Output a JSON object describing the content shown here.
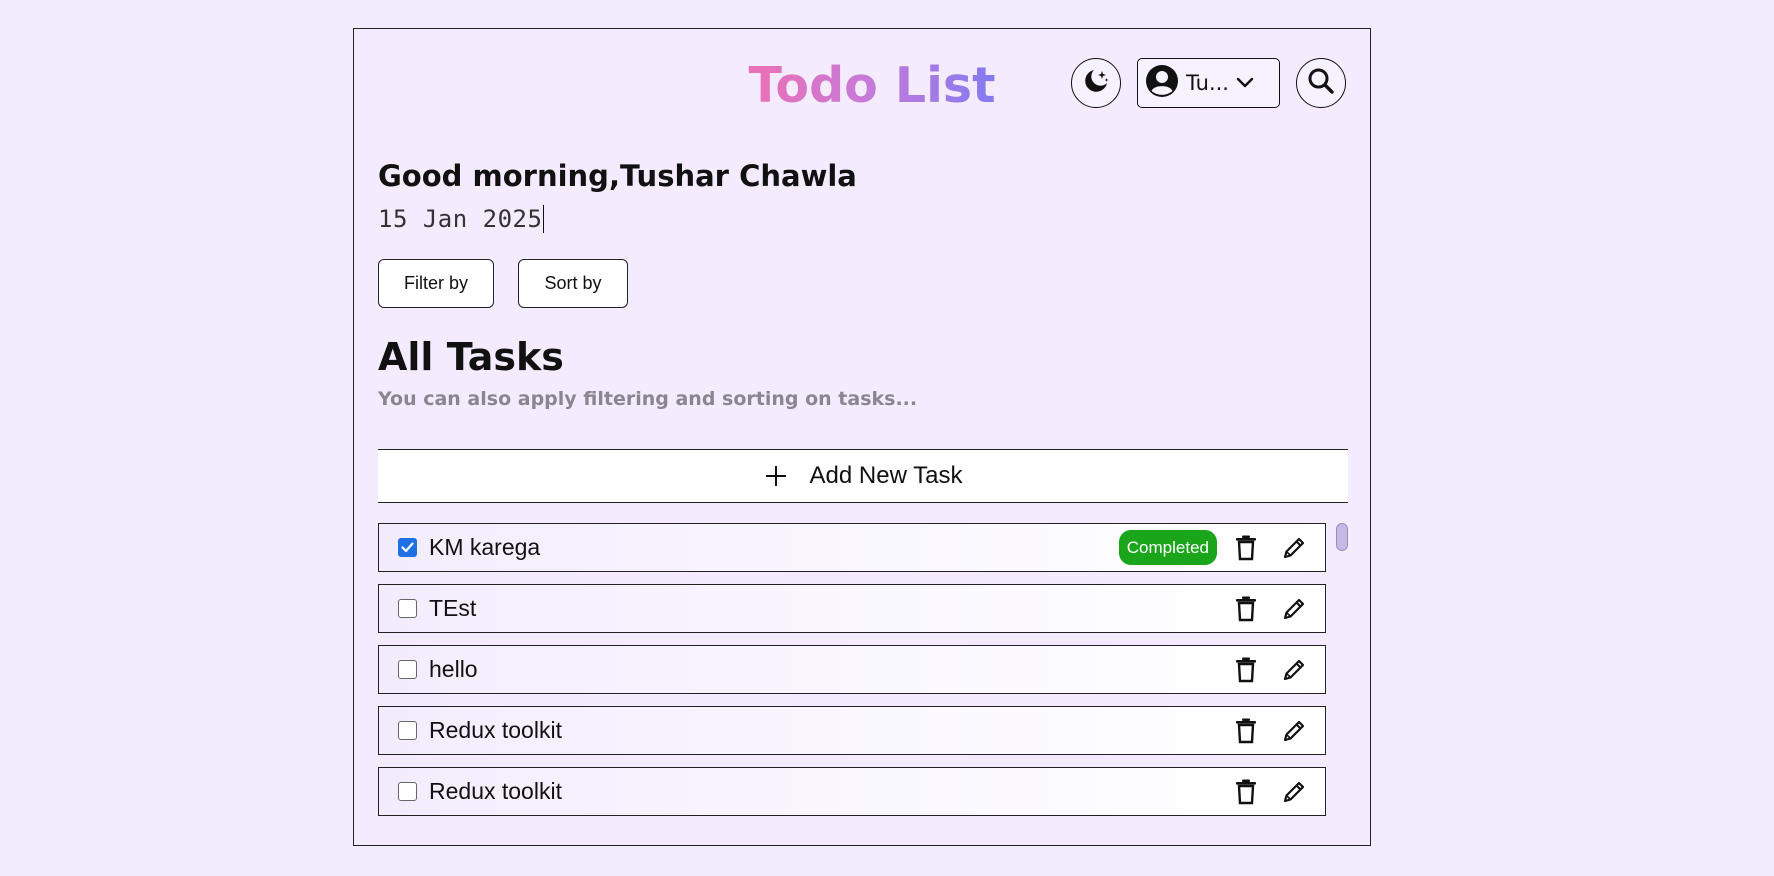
{
  "header": {
    "title": "Todo List",
    "theme_icon": "moon-stars-icon",
    "search_icon": "search-icon",
    "user": {
      "name": "Tu...",
      "avatar_icon": "user-circle-icon",
      "dropdown_icon": "chevron-down-icon"
    }
  },
  "greeting": {
    "text": "Good morning,Tushar Chawla",
    "date": "15 Jan 2025"
  },
  "controls": {
    "filter_label": "Filter by",
    "sort_label": "Sort by"
  },
  "section": {
    "title": "All Tasks",
    "hint": "You can also apply filtering and sorting on tasks..."
  },
  "add_task": {
    "label": "Add New Task",
    "icon": "plus-icon"
  },
  "tasks": [
    {
      "name": "KM karega",
      "checked": true,
      "status": "Completed"
    },
    {
      "name": "TEst",
      "checked": false,
      "status": ""
    },
    {
      "name": "hello",
      "checked": false,
      "status": ""
    },
    {
      "name": "Redux toolkit",
      "checked": false,
      "status": ""
    },
    {
      "name": "Redux toolkit",
      "checked": false,
      "status": ""
    }
  ],
  "colors": {
    "background": "#f3ebfe",
    "title_gradient_start": "#ef6fb2",
    "title_gradient_end": "#7f7af2",
    "completed_badge": "#1ba51b",
    "checkbox_checked": "#1f6fe5"
  }
}
